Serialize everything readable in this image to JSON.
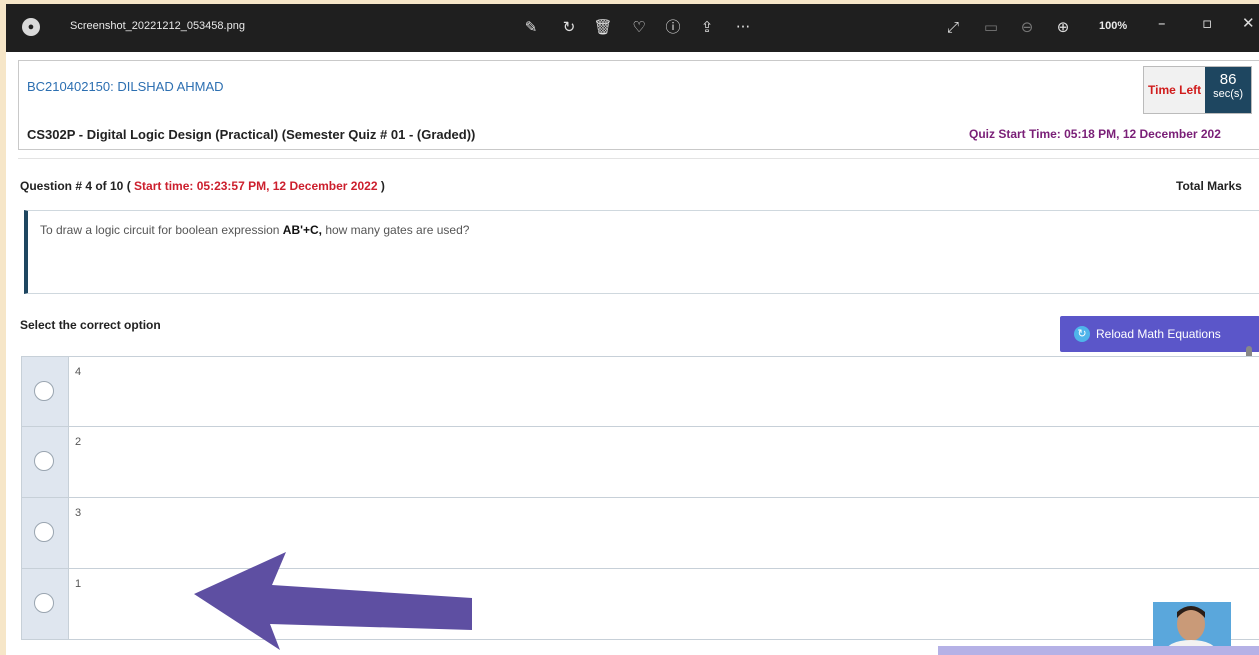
{
  "viewer": {
    "file_name": "Screenshot_20221212_053458.png",
    "zoom": "100%",
    "icons": [
      "edit-icon",
      "rotate-icon",
      "delete-icon",
      "heart-icon",
      "info-icon",
      "share-icon",
      "more-icon"
    ]
  },
  "quiz": {
    "student": "BC210402150: DILSHAD AHMAD",
    "course": "CS302P - Digital Logic Design (Practical) (Semester Quiz # 01 - (Graded))",
    "time_left_label": "Time Left",
    "time_left_value": "86",
    "time_left_unit": "sec(s)",
    "quiz_start": "Quiz Start Time: 05:18 PM, 12 December 202",
    "question_prefix": "Question # 4 of 10 (",
    "question_start": "Start time: 05:23:57 PM, 12 December 2022",
    "question_suffix": ")",
    "total_marks": "Total Marks",
    "question_text_pre": "To draw a logic circuit for boolean expression ",
    "question_expr": "AB'+C,",
    "question_text_post": " how many gates are used?",
    "select_label": "Select the correct option",
    "reload_button": "Reload Math Equations",
    "options": [
      "4",
      "2",
      "3",
      "1"
    ]
  },
  "colors": {
    "student": "#2c6fb1",
    "start_time": "#cc1f2d",
    "quiz_start": "#7a1f77",
    "button": "#5b56c9",
    "arrow": "#5e4fa2"
  }
}
